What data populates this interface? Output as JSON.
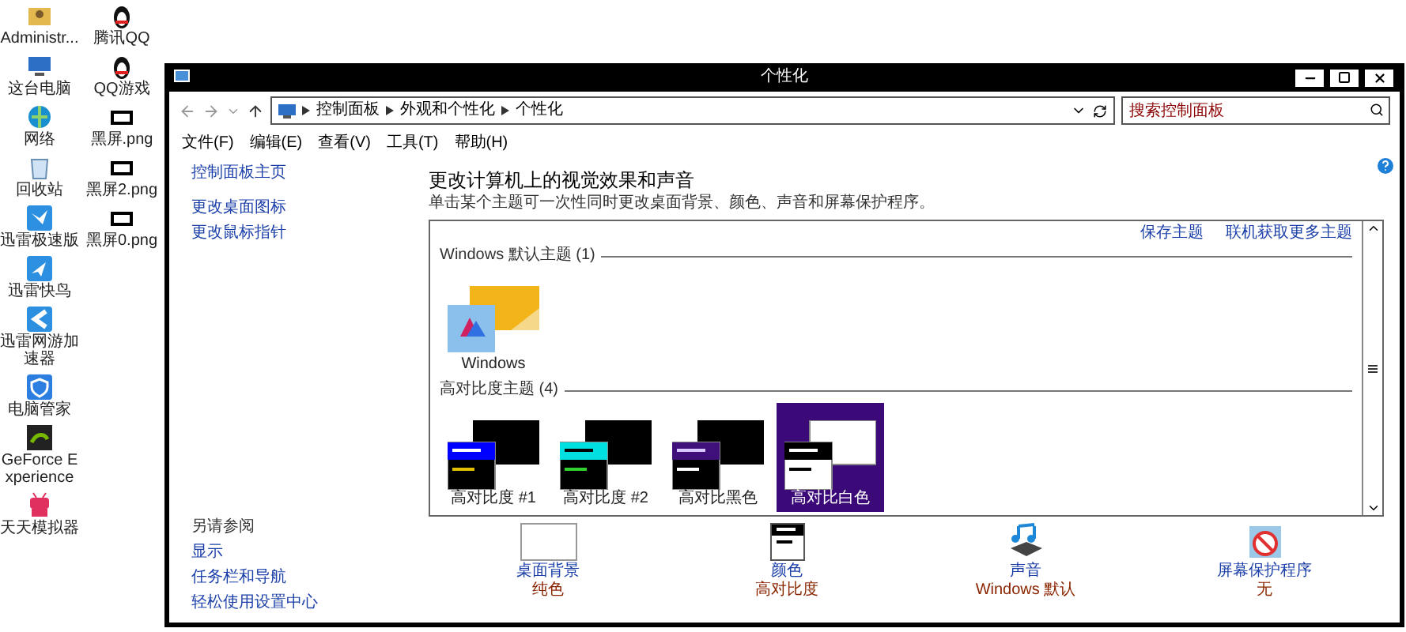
{
  "desktop": {
    "columns": [
      [
        {
          "label": "Administr...",
          "kind": "folder"
        },
        {
          "label": "这台电脑",
          "kind": "monitor"
        },
        {
          "label": "网络",
          "kind": "globe"
        },
        {
          "label": "回收站",
          "kind": "bin"
        },
        {
          "label": "迅雷极速版",
          "kind": "bird"
        },
        {
          "label": "迅雷快鸟",
          "kind": "plane"
        },
        {
          "label": "迅雷网游加速器",
          "kind": "arrow"
        },
        {
          "label": "电脑管家",
          "kind": "shield"
        },
        {
          "label": "GeForce Experience",
          "kind": "graphics"
        },
        {
          "label": "天天模拟器",
          "kind": "robot"
        }
      ],
      [
        {
          "label": "腾讯QQ",
          "kind": "penguin"
        },
        {
          "label": "QQ游戏",
          "kind": "penguin"
        },
        {
          "label": "黑屏.png",
          "kind": "screen"
        },
        {
          "label": "黑屏2.png",
          "kind": "screen"
        },
        {
          "label": "黑屏0.png",
          "kind": "screen"
        }
      ]
    ]
  },
  "window": {
    "title": "个性化",
    "address": {
      "crumbs": [
        "控制面板",
        "外观和个性化",
        "个性化"
      ]
    },
    "search": {
      "placeholder": "搜索控制面板"
    },
    "menu": [
      "文件(F)",
      "编辑(E)",
      "查看(V)",
      "工具(T)",
      "帮助(H)"
    ],
    "sidebar": {
      "links": [
        "控制面板主页",
        "更改桌面图标",
        "更改鼠标指针"
      ],
      "see_also": {
        "heading": "另请参阅",
        "links": [
          "显示",
          "任务栏和导航",
          "轻松使用设置中心"
        ]
      }
    },
    "heading": "更改计算机上的视觉效果和声音",
    "description": "单击某个主题可一次性同时更改桌面背景、颜色、声音和屏幕保护程序。",
    "theme_links": [
      "保存主题",
      "联机获取更多主题"
    ],
    "theme_groups": [
      {
        "title": "Windows 默认主题 (1)",
        "themes": [
          {
            "name": "Windows",
            "kind": "windows",
            "selected": false
          }
        ]
      },
      {
        "title": "高对比度主题 (4)",
        "themes": [
          {
            "name": "高对比度 #1",
            "kind": "contrast-blue",
            "selected": false
          },
          {
            "name": "高对比度 #2",
            "kind": "contrast-cyan",
            "selected": false
          },
          {
            "name": "高对比黑色",
            "kind": "contrast-purple",
            "selected": false
          },
          {
            "name": "高对比白色",
            "kind": "contrast-white",
            "selected": true
          }
        ]
      }
    ],
    "settings": [
      {
        "kind": "background",
        "label": "桌面背景",
        "value": "纯色"
      },
      {
        "kind": "color",
        "label": "颜色",
        "value": "高对比度"
      },
      {
        "kind": "sound",
        "label": "声音",
        "value": "Windows 默认"
      },
      {
        "kind": "screensaver",
        "label": "屏幕保护程序",
        "value": "无"
      }
    ]
  }
}
